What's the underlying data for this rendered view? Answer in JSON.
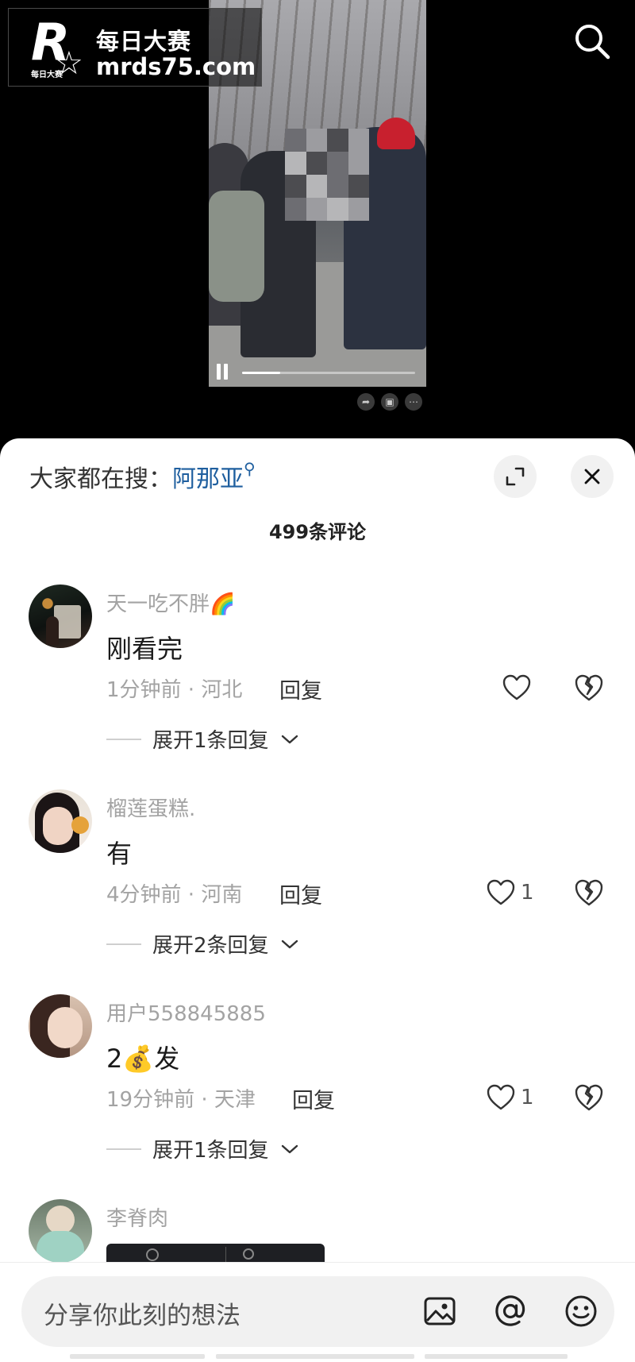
{
  "watermark": {
    "logo_letter": "R",
    "logo_small": "每日大赛",
    "title": "每日大赛",
    "url": "mrds75.com"
  },
  "video": {
    "progress": 0.22,
    "state": "playing"
  },
  "panel": {
    "hot_search_label": "大家都在搜：",
    "hot_search_keyword": "阿那亚",
    "comment_count": "499条评论"
  },
  "comments": [
    {
      "username": "天一吃不胖🌈",
      "content": "刚看完",
      "meta": "1分钟前 · 河北",
      "reply": "回复",
      "likes": "",
      "expand": "展开1条回复"
    },
    {
      "username": "榴莲蛋糕.",
      "content": "有",
      "meta": "4分钟前 · 河南",
      "reply": "回复",
      "likes": "1",
      "expand": "展开2条回复"
    },
    {
      "username": "用户558845885",
      "content": "2💰发",
      "meta": "19分钟前 · 天津",
      "reply": "回复",
      "likes": "1",
      "expand": "展开1条回复"
    },
    {
      "username": "李脊肉"
    }
  ],
  "input": {
    "placeholder": "分享你此刻的想法"
  },
  "icons": {
    "search": "search-icon",
    "expand": "expand-icon",
    "close": "close-icon",
    "like": "heart-icon",
    "dislike": "broken-heart-icon",
    "image": "image-icon",
    "mention": "at-icon",
    "emoji": "emoji-icon"
  }
}
